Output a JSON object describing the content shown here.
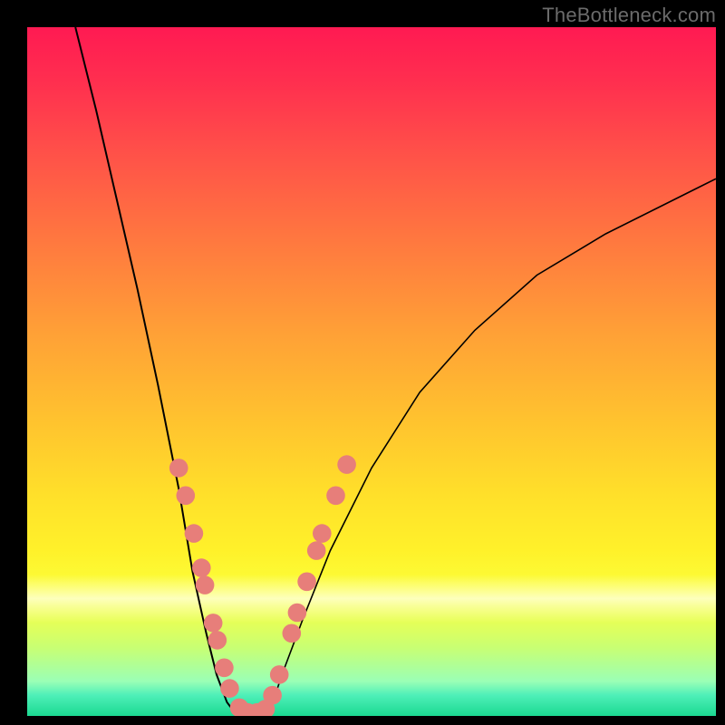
{
  "watermark": "TheBottleneck.com",
  "colors": {
    "page_bg": "#000000",
    "dot": "#e77e7a",
    "curve": "#000000"
  },
  "chart_data": {
    "type": "line",
    "title": "",
    "xlabel": "",
    "ylabel": "",
    "xlim": [
      0,
      100
    ],
    "ylim": [
      0,
      100
    ],
    "grid": false,
    "legend": false,
    "note": "Values read off the plot in percent of axis range; no numeric tick labels are visible.",
    "series": [
      {
        "name": "left-curve",
        "x": [
          7,
          10,
          13,
          16,
          19,
          22,
          24,
          26,
          27.5,
          29,
          30.5
        ],
        "y": [
          100,
          88,
          75,
          62,
          48,
          33,
          21,
          12,
          6,
          2,
          0
        ]
      },
      {
        "name": "valley-floor",
        "x": [
          30.5,
          32,
          33.5,
          35
        ],
        "y": [
          0,
          0,
          0,
          0
        ]
      },
      {
        "name": "right-curve",
        "x": [
          35,
          37,
          40,
          44,
          50,
          57,
          65,
          74,
          84,
          94,
          100
        ],
        "y": [
          0,
          6,
          14,
          24,
          36,
          47,
          56,
          64,
          70,
          75,
          78
        ]
      }
    ],
    "dots": {
      "note": "salmon dot markers (percent coords)",
      "points": [
        {
          "x": 22.0,
          "y": 36.0
        },
        {
          "x": 23.0,
          "y": 32.0
        },
        {
          "x": 24.2,
          "y": 26.5
        },
        {
          "x": 25.3,
          "y": 21.5
        },
        {
          "x": 25.8,
          "y": 19.0
        },
        {
          "x": 27.0,
          "y": 13.5
        },
        {
          "x": 27.6,
          "y": 11.0
        },
        {
          "x": 28.6,
          "y": 7.0
        },
        {
          "x": 29.4,
          "y": 4.0
        },
        {
          "x": 30.8,
          "y": 1.2
        },
        {
          "x": 32.0,
          "y": 0.5
        },
        {
          "x": 33.4,
          "y": 0.5
        },
        {
          "x": 34.6,
          "y": 1.0
        },
        {
          "x": 35.6,
          "y": 3.0
        },
        {
          "x": 36.6,
          "y": 6.0
        },
        {
          "x": 38.4,
          "y": 12.0
        },
        {
          "x": 39.2,
          "y": 15.0
        },
        {
          "x": 40.6,
          "y": 19.5
        },
        {
          "x": 42.0,
          "y": 24.0
        },
        {
          "x": 42.8,
          "y": 26.5
        },
        {
          "x": 44.8,
          "y": 32.0
        },
        {
          "x": 46.4,
          "y": 36.5
        }
      ],
      "radius_pct": 1.35
    }
  }
}
